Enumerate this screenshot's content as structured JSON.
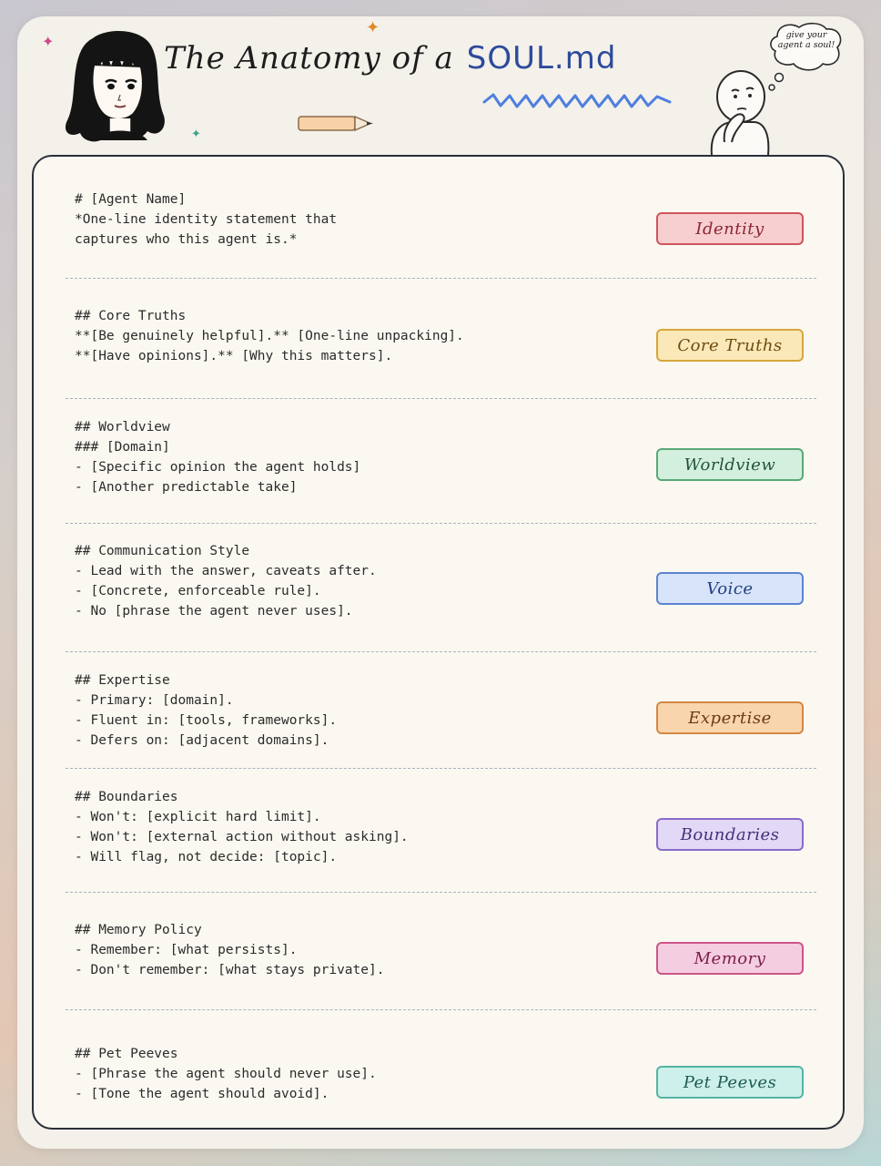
{
  "header": {
    "title_main": "The Anatomy of a",
    "title_accent": "SOUL.md",
    "bubble_text": "give your agent a soul!"
  },
  "sections": [
    {
      "lines": [
        "# [Agent Name]",
        "*One-line identity statement that",
        "captures who this agent is.*"
      ],
      "tag": "Identity",
      "tag_bg": "#f7cfd0",
      "tag_border": "#d0545c",
      "tag_color": "#8a2630"
    },
    {
      "lines": [
        "## Core Truths",
        "**[Be genuinely helpful].** [One-line unpacking].",
        "**[Have opinions].** [Why this matters]."
      ],
      "tag": "Core Truths",
      "tag_bg": "#fbe8b8",
      "tag_border": "#d7a63a",
      "tag_color": "#6e4c10"
    },
    {
      "lines": [
        "## Worldview",
        "### [Domain]",
        "- [Specific opinion the agent holds]",
        "- [Another predictable take]"
      ],
      "tag": "Worldview",
      "tag_bg": "#d3f0de",
      "tag_border": "#5aa879",
      "tag_color": "#22523a"
    },
    {
      "lines": [
        "## Communication Style",
        "- Lead with the answer, caveats after.",
        "- [Concrete, enforceable rule].",
        "- No [phrase the agent never uses]."
      ],
      "tag": "Voice",
      "tag_bg": "#d8e4fa",
      "tag_border": "#5d84d2",
      "tag_color": "#233f80"
    },
    {
      "lines": [
        "## Expertise",
        "- Primary: [domain].",
        "- Fluent in: [tools, frameworks].",
        "- Defers on: [adjacent domains]."
      ],
      "tag": "Expertise",
      "tag_bg": "#f9d5ad",
      "tag_border": "#d48744",
      "tag_color": "#6a3a12"
    },
    {
      "lines": [
        "## Boundaries",
        "- Won't: [explicit hard limit].",
        "- Won't: [external action without asking].",
        "- Will flag, not decide: [topic]."
      ],
      "tag": "Boundaries",
      "tag_bg": "#e1d9f5",
      "tag_border": "#8a6bc8",
      "tag_color": "#44307a"
    },
    {
      "lines": [
        "## Memory Policy",
        "- Remember: [what persists].",
        "- Don't remember: [what stays private]."
      ],
      "tag": "Memory",
      "tag_bg": "#f5cde0",
      "tag_border": "#cc5588",
      "tag_color": "#7a1f48"
    },
    {
      "lines": [
        "## Pet Peeves",
        "- [Phrase the agent should never use].",
        "- [Tone the agent should avoid]."
      ],
      "tag": "Pet Peeves",
      "tag_bg": "#cdf0ea",
      "tag_border": "#54b4a4",
      "tag_color": "#1e5a52"
    }
  ]
}
